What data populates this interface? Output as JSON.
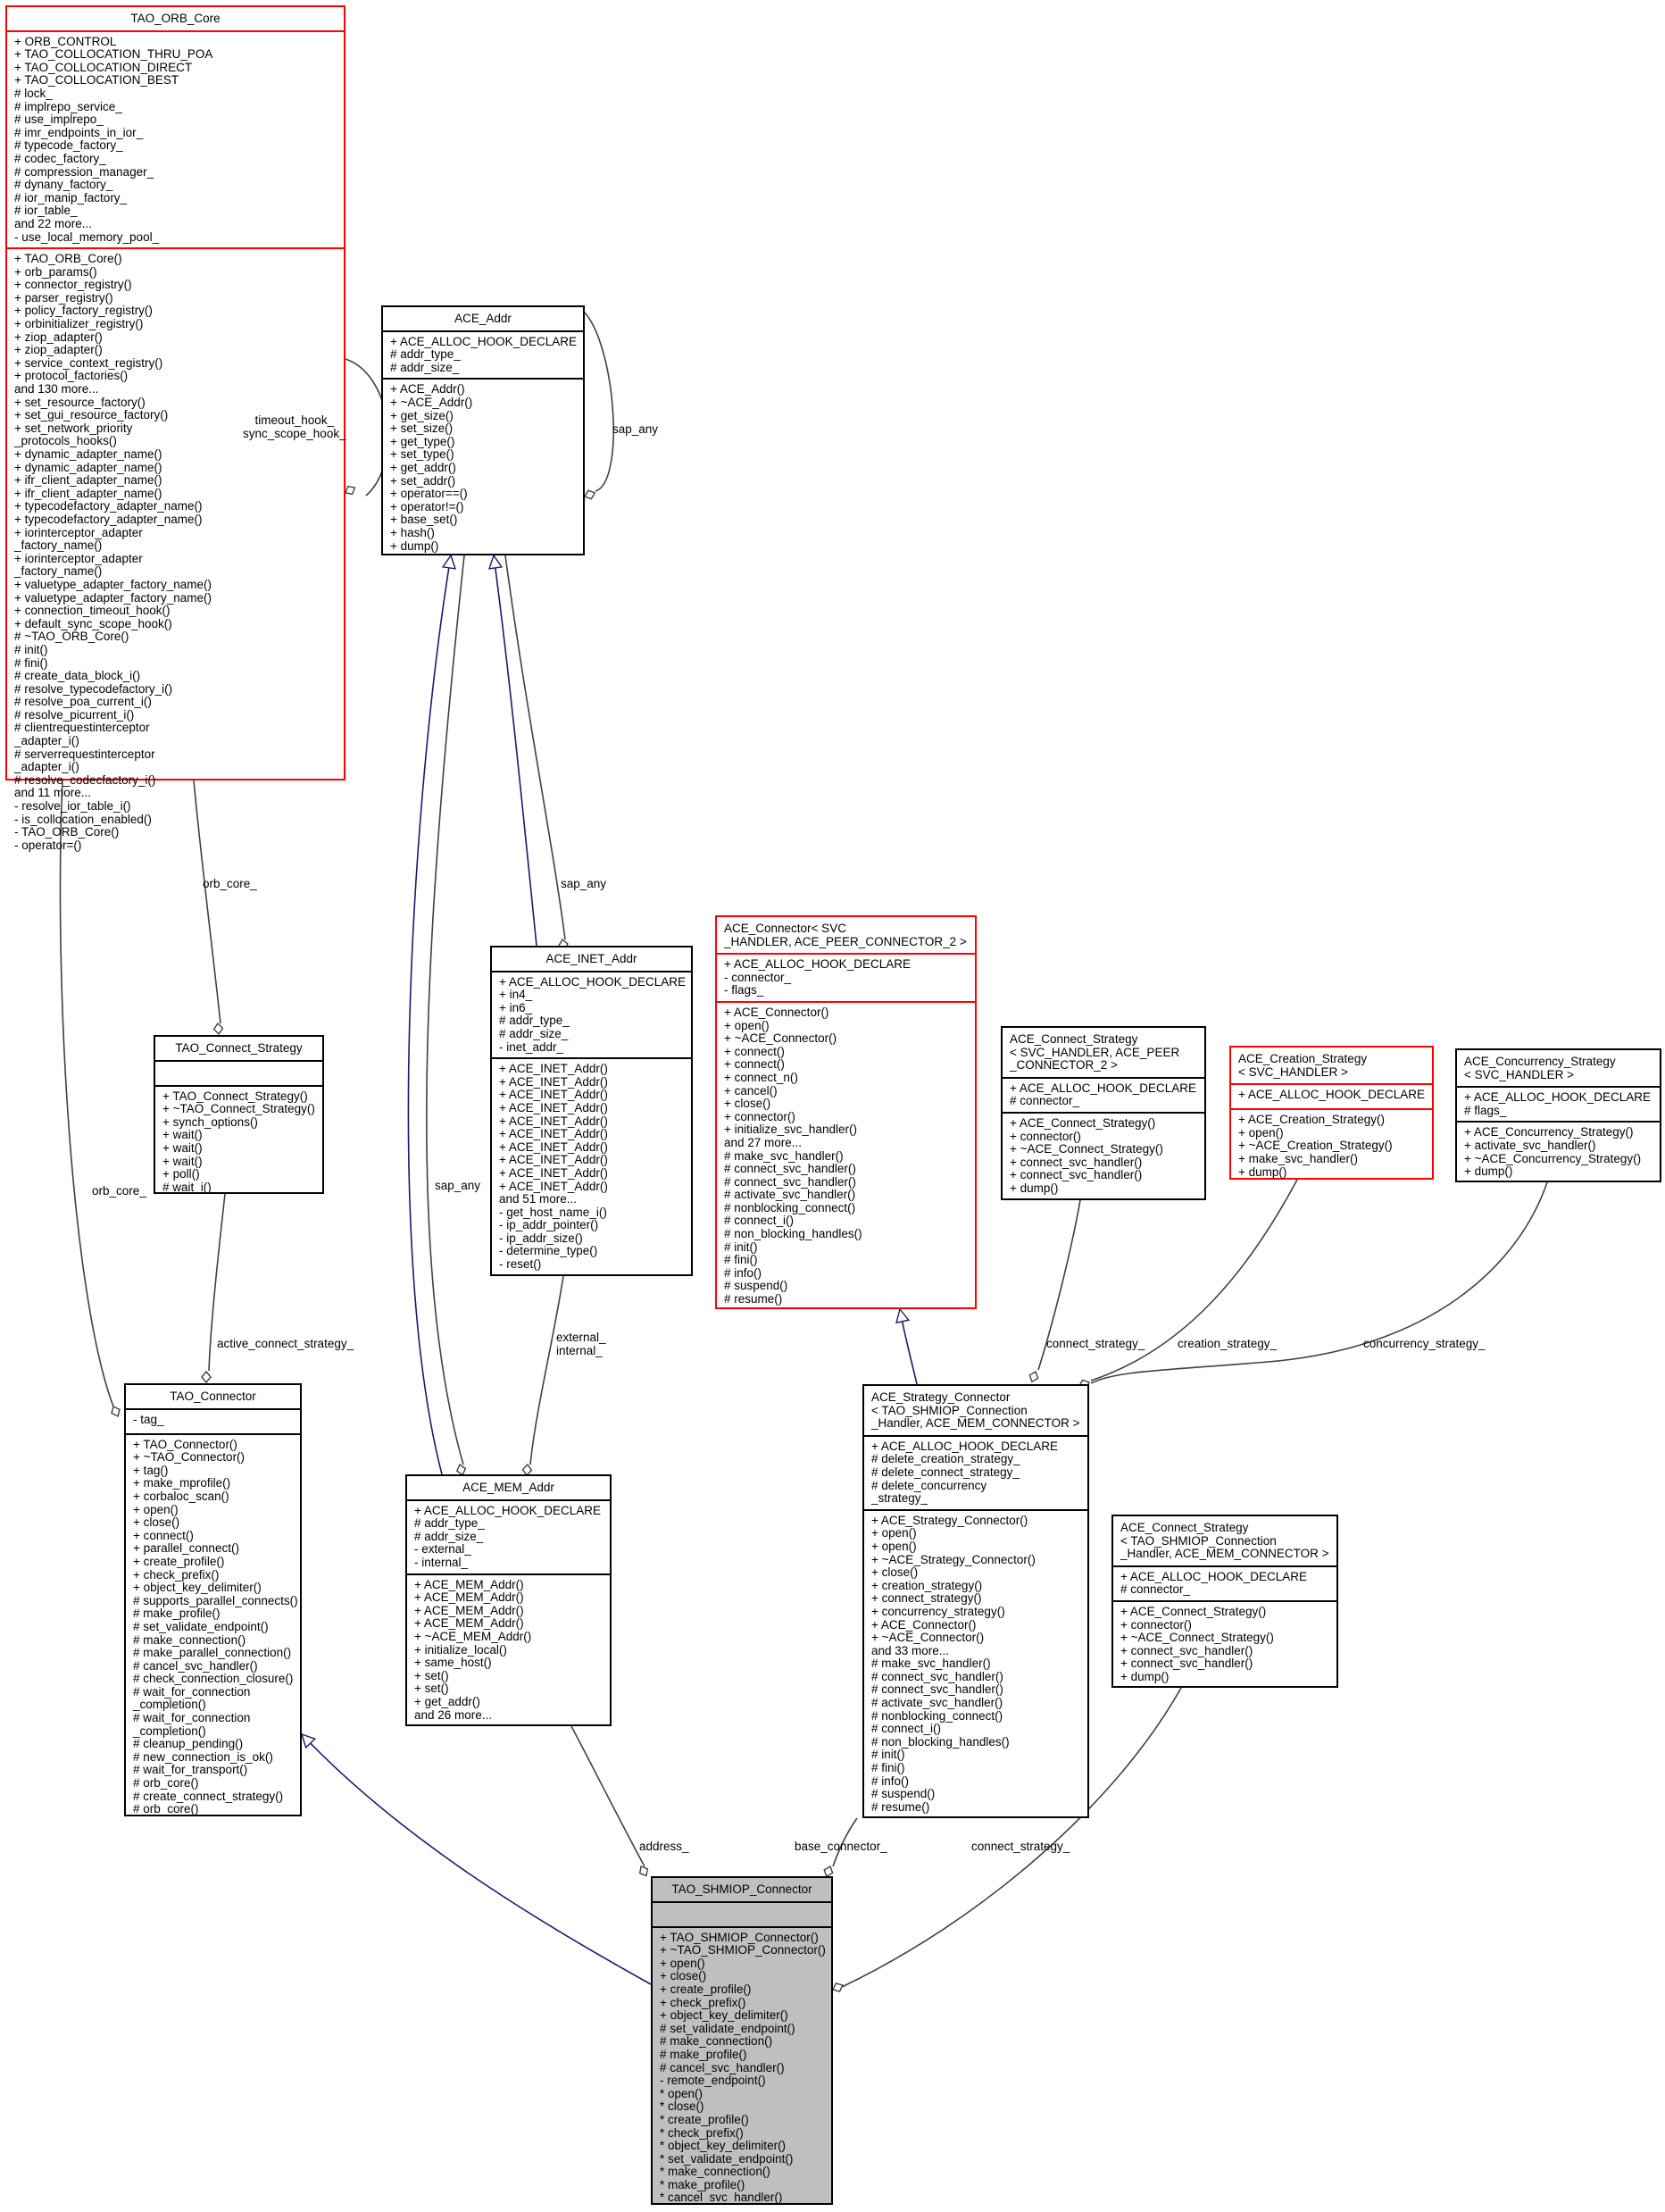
{
  "diagram": {
    "classes": {
      "orb_core": {
        "title": "TAO_ORB_Core",
        "attributes": [
          "+ ORB_CONTROL",
          "+ TAO_COLLOCATION_THRU_POA",
          "+ TAO_COLLOCATION_DIRECT",
          "+ TAO_COLLOCATION_BEST",
          "# lock_",
          "# implrepo_service_",
          "# use_implrepo_",
          "# imr_endpoints_in_ior_",
          "# typecode_factory_",
          "# codec_factory_",
          "# compression_manager_",
          "# dynany_factory_",
          "# ior_manip_factory_",
          "# ior_table_",
          "and 22 more...",
          "- use_local_memory_pool_"
        ],
        "methods": [
          "+ TAO_ORB_Core()",
          "+ orb_params()",
          "+ connector_registry()",
          "+ parser_registry()",
          "+ policy_factory_registry()",
          "+ orbinitializer_registry()",
          "+ ziop_adapter()",
          "+ ziop_adapter()",
          "+ service_context_registry()",
          "+ protocol_factories()",
          "and 130 more...",
          "+ set_resource_factory()",
          "+ set_gui_resource_factory()",
          "+ set_network_priority",
          "_protocols_hooks()",
          "+ dynamic_adapter_name()",
          "+ dynamic_adapter_name()",
          "+ ifr_client_adapter_name()",
          "+ ifr_client_adapter_name()",
          "+ typecodefactory_adapter_name()",
          "+ typecodefactory_adapter_name()",
          "+ iorinterceptor_adapter",
          "_factory_name()",
          "+ iorinterceptor_adapter",
          "_factory_name()",
          "+ valuetype_adapter_factory_name()",
          "+ valuetype_adapter_factory_name()",
          "+ connection_timeout_hook()",
          "+ default_sync_scope_hook()",
          "# ~TAO_ORB_Core()",
          "# init()",
          "# fini()",
          "# create_data_block_i()",
          "# resolve_typecodefactory_i()",
          "# resolve_poa_current_i()",
          "# resolve_picurrent_i()",
          "# clientrequestinterceptor",
          "_adapter_i()",
          "# serverrequestinterceptor",
          "_adapter_i()",
          "# resolve_codecfactory_i()",
          "and 11 more...",
          "- resolve_ior_table_i()",
          "- is_collocation_enabled()",
          "- TAO_ORB_Core()",
          "- operator=()"
        ]
      },
      "ace_addr": {
        "title": "ACE_Addr",
        "attributes": [
          "+ ACE_ALLOC_HOOK_DECLARE",
          "# addr_type_",
          "# addr_size_"
        ],
        "methods": [
          "+ ACE_Addr()",
          "+ ~ACE_Addr()",
          "+ get_size()",
          "+ set_size()",
          "+ get_type()",
          "+ set_type()",
          "+ get_addr()",
          "+ set_addr()",
          "+ operator==()",
          "+ operator!=()",
          "+ base_set()",
          "+ hash()",
          "+ dump()"
        ]
      },
      "ace_inet_addr": {
        "title": "ACE_INET_Addr",
        "attributes": [
          "+ ACE_ALLOC_HOOK_DECLARE",
          "+ in4_",
          "+ in6_",
          "# addr_type_",
          "# addr_size_",
          "- inet_addr_"
        ],
        "methods": [
          "+ ACE_INET_Addr()",
          "+ ACE_INET_Addr()",
          "+ ACE_INET_Addr()",
          "+ ACE_INET_Addr()",
          "+ ACE_INET_Addr()",
          "+ ACE_INET_Addr()",
          "+ ACE_INET_Addr()",
          "+ ACE_INET_Addr()",
          "+ ACE_INET_Addr()",
          "+ ACE_INET_Addr()",
          "and 51 more...",
          "- get_host_name_i()",
          "- ip_addr_pointer()",
          "- ip_addr_size()",
          "- determine_type()",
          "- reset()"
        ]
      },
      "ace_connector": {
        "title": "ACE_Connector< SVC\n_HANDLER, ACE_PEER_CONNECTOR_2 >",
        "attributes": [
          "+ ACE_ALLOC_HOOK_DECLARE",
          "- connector_",
          "- flags_"
        ],
        "methods": [
          "+ ACE_Connector()",
          "+ open()",
          "+ ~ACE_Connector()",
          "+ connect()",
          "+ connect()",
          "+ connect_n()",
          "+ cancel()",
          "+ close()",
          "+ connector()",
          "+ initialize_svc_handler()",
          "and 27 more...",
          "# make_svc_handler()",
          "# connect_svc_handler()",
          "# connect_svc_handler()",
          "# activate_svc_handler()",
          "# nonblocking_connect()",
          "# connect_i()",
          "# non_blocking_handles()",
          "# init()",
          "# fini()",
          "# info()",
          "# suspend()",
          "# resume()"
        ]
      },
      "ace_connect_strategy_svc": {
        "title": "ACE_Connect_Strategy\n< SVC_HANDLER, ACE_PEER\n_CONNECTOR_2 >",
        "attributes": [
          "+ ACE_ALLOC_HOOK_DECLARE",
          "# connector_"
        ],
        "methods": [
          "+ ACE_Connect_Strategy()",
          "+ connector()",
          "+ ~ACE_Connect_Strategy()",
          "+ connect_svc_handler()",
          "+ connect_svc_handler()",
          "+ dump()"
        ]
      },
      "ace_creation_strategy": {
        "title": "ACE_Creation_Strategy\n< SVC_HANDLER >",
        "attributes": [
          "+ ACE_ALLOC_HOOK_DECLARE"
        ],
        "methods": [
          "+ ACE_Creation_Strategy()",
          "+ open()",
          "+ ~ACE_Creation_Strategy()",
          "+ make_svc_handler()",
          "+ dump()"
        ]
      },
      "ace_concurrency_strategy": {
        "title": "ACE_Concurrency_Strategy\n< SVC_HANDLER >",
        "attributes": [
          "+ ACE_ALLOC_HOOK_DECLARE",
          "# flags_"
        ],
        "methods": [
          "+ ACE_Concurrency_Strategy()",
          "+ activate_svc_handler()",
          "+ ~ACE_Concurrency_Strategy()",
          "+ dump()"
        ]
      },
      "tao_connect_strategy": {
        "title": "TAO_Connect_Strategy",
        "attributes": [],
        "methods": [
          "+ TAO_Connect_Strategy()",
          "+ ~TAO_Connect_Strategy()",
          "+ synch_options()",
          "+ wait()",
          "+ wait()",
          "+ wait()",
          "+ poll()",
          "# wait_i()"
        ]
      },
      "tao_connector": {
        "title": "TAO_Connector",
        "attributes": [
          "- tag_"
        ],
        "methods": [
          "+ TAO_Connector()",
          "+ ~TAO_Connector()",
          "+ tag()",
          "+ make_mprofile()",
          "+ corbaloc_scan()",
          "+ open()",
          "+ close()",
          "+ connect()",
          "+ parallel_connect()",
          "+ create_profile()",
          "+ check_prefix()",
          "+ object_key_delimiter()",
          "# supports_parallel_connects()",
          "# make_profile()",
          "# set_validate_endpoint()",
          "# make_connection()",
          "# make_parallel_connection()",
          "# cancel_svc_handler()",
          "# check_connection_closure()",
          "# wait_for_connection",
          "_completion()",
          "# wait_for_connection",
          "_completion()",
          "# cleanup_pending()",
          "# new_connection_is_ok()",
          "# wait_for_transport()",
          "# orb_core()",
          "# create_connect_strategy()",
          "# orb_core()"
        ]
      },
      "ace_mem_addr": {
        "title": "ACE_MEM_Addr",
        "attributes": [
          "+ ACE_ALLOC_HOOK_DECLARE",
          "# addr_type_",
          "# addr_size_",
          "- external_",
          "- internal_"
        ],
        "methods": [
          "+ ACE_MEM_Addr()",
          "+ ACE_MEM_Addr()",
          "+ ACE_MEM_Addr()",
          "+ ACE_MEM_Addr()",
          "+ ~ACE_MEM_Addr()",
          "+ initialize_local()",
          "+ same_host()",
          "+ set()",
          "+ set()",
          "+ get_addr()",
          "and 26 more..."
        ]
      },
      "ace_strategy_connector": {
        "title": "ACE_Strategy_Connector\n< TAO_SHMIOP_Connection\n_Handler, ACE_MEM_CONNECTOR >",
        "attributes": [
          "+ ACE_ALLOC_HOOK_DECLARE",
          "# delete_creation_strategy_",
          "# delete_connect_strategy_",
          "# delete_concurrency",
          "_strategy_"
        ],
        "methods": [
          "+ ACE_Strategy_Connector()",
          "+ open()",
          "+ open()",
          "+ ~ACE_Strategy_Connector()",
          "+ close()",
          "+ creation_strategy()",
          "+ connect_strategy()",
          "+ concurrency_strategy()",
          "+ ACE_Connector()",
          "+ ~ACE_Connector()",
          "and 33 more...",
          "# make_svc_handler()",
          "# connect_svc_handler()",
          "# connect_svc_handler()",
          "# activate_svc_handler()",
          "# nonblocking_connect()",
          "# connect_i()",
          "# non_blocking_handles()",
          "# init()",
          "# fini()",
          "# info()",
          "# suspend()",
          "# resume()"
        ]
      },
      "ace_connect_strategy_shmiop": {
        "title": "ACE_Connect_Strategy\n< TAO_SHMIOP_Connection\n_Handler, ACE_MEM_CONNECTOR >",
        "attributes": [
          "+ ACE_ALLOC_HOOK_DECLARE",
          "# connector_"
        ],
        "methods": [
          "+ ACE_Connect_Strategy()",
          "+ connector()",
          "+ ~ACE_Connect_Strategy()",
          "+ connect_svc_handler()",
          "+ connect_svc_handler()",
          "+ dump()"
        ]
      },
      "tao_shmiop_connector": {
        "title": "TAO_SHMIOP_Connector",
        "attributes": [],
        "methods": [
          "+ TAO_SHMIOP_Connector()",
          "+ ~TAO_SHMIOP_Connector()",
          "+ open()",
          "+ close()",
          "+ create_profile()",
          "+ check_prefix()",
          "+ object_key_delimiter()",
          "# set_validate_endpoint()",
          "# make_connection()",
          "# make_profile()",
          "# cancel_svc_handler()",
          "- remote_endpoint()",
          "* open()",
          "* close()",
          "* create_profile()",
          "* check_prefix()",
          "* object_key_delimiter()",
          "* set_validate_endpoint()",
          "* make_connection()",
          "* make_profile()",
          "* cancel_svc_handler()"
        ]
      }
    },
    "edge_labels": {
      "orb_self": "timeout_hook_\nsync_scope_hook_",
      "addr_self": "sap_any",
      "inet_sap": "sap_any",
      "mem_sap": "sap_any",
      "orb_core_strategy": "orb_core_",
      "orb_core_connector": "orb_core_",
      "active_connect_strategy": "active_connect_strategy_",
      "external_internal": "external_\ninternal_",
      "connect_strategy_svc": "connect_strategy_",
      "creation_strategy": "creation_strategy_",
      "concurrency_strategy": "concurrency_strategy_",
      "address": "address_",
      "base_connector": "base_connector_",
      "connect_strategy_shmiop": "connect_strategy_"
    },
    "colors": {
      "inheritance_edge": "#191970",
      "usage_edge": "#404040",
      "incomplete_border": "#ff0000",
      "focus_fill": "#bfbfbf"
    }
  }
}
